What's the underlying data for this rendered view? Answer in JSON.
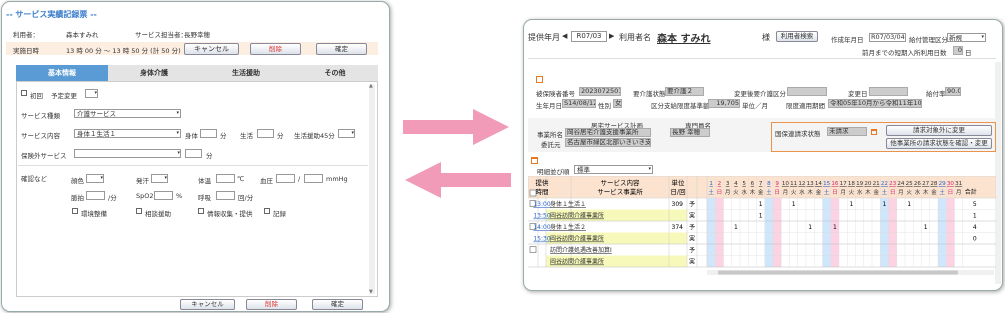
{
  "left": {
    "title": "-- サービス実績記録票 --",
    "user_label": "利用者：",
    "user_name": "森本すみれ",
    "staff_label": "サービス担当者：",
    "staff_name": "長野幸穂",
    "time_label": "実施日時",
    "time_value": "13 時 00 分 〜 13 時 50 分 (計 50 分)",
    "cancel": "キャンセル",
    "delete": "削除",
    "confirm": "確定",
    "tabs": [
      "基本情報",
      "身体介護",
      "生活援助",
      "その他"
    ],
    "first_visit": "初回",
    "schedule_change": "予定変更",
    "service_type_label": "サービス種類",
    "service_type_value": "介護サービス",
    "service_content_label": "サービス内容",
    "service_content_value": "身体１生活１",
    "body_label": "身体",
    "life_label": "生活",
    "life45_label": "生活援助45分",
    "minute": "分",
    "insurance_label": "保険外サービス",
    "confirm_label": "確認など",
    "color_label": "顔色",
    "sweat_label": "発汗",
    "temp_label": "体温",
    "temp_unit": "℃",
    "bp_label": "血圧",
    "bp_sep": "/",
    "bp_unit": "mmHg",
    "pulse_label": "脈拍",
    "pulse_unit": "/分",
    "spo2_label": "SpO2",
    "spo2_unit": "%",
    "resp_label": "呼吸",
    "resp_unit": "回/分",
    "cb1": "環境整備",
    "cb2": "相談援助",
    "cb3": "情報収集・提供",
    "cb4": "記録"
  },
  "right": {
    "year_label": "提供年月",
    "year_value": "R07/03",
    "user_name_label": "利用者名",
    "user_name": "森本 すみれ",
    "sama": "様",
    "search_btn": "利用者検索",
    "created_label": "作成年月日",
    "created_value": "R07/03/04",
    "mgmt_label": "給付管理区分",
    "mgmt_value": "新規",
    "short_label": "前月までの短期入所利用日数",
    "short_value": "0",
    "short_unit": "日",
    "insured_label": "被保険者番号",
    "insured_value": "2023072501",
    "care_label": "要介護状態",
    "care_value": "要介護２",
    "change_label": "変更後要介護区分",
    "change_date_label": "変更日",
    "benefit_label": "給付率",
    "benefit_value": "90.0",
    "birth_label": "生年月日",
    "birth_value": "S14/08/12",
    "sex_label": "性別",
    "sex_value": "女",
    "limit_label": "区分支給限度基準額",
    "limit_value": "19,705",
    "limit_unit": "単位／月",
    "period_label": "限度適用期間",
    "period_value": "令和05年10月から令和11年10月まで",
    "plan_label": "居宅サービス計画",
    "office_label": "事業所名",
    "office_value": "岡谷居宅介護支援事業所",
    "consign_label": "委託元",
    "consign_value": "名古屋市緑区北部いきいき支援センタ",
    "specialist_label": "専門員名",
    "specialist_value": "長野 幸穂",
    "kokuho_label": "国保連請求状態",
    "kokuho_value": "未請求",
    "btn_exclude": "請求対象外に変更",
    "btn_other": "他事業所の請求状態を確認・変更",
    "sort_label": "明細並び順",
    "sort_value": "標準",
    "head_time1": "提供",
    "head_time2": "時間",
    "head_svc1": "サービス内容",
    "head_svc2": "サービス事業所",
    "head_unit1": "単位",
    "head_unit2": "日/回",
    "head_total": "合計",
    "days": [
      "1",
      "2",
      "3",
      "4",
      "5",
      "6",
      "7",
      "8",
      "9",
      "10",
      "11",
      "12",
      "13",
      "14",
      "15",
      "16",
      "17",
      "18",
      "19",
      "20",
      "21",
      "22",
      "23",
      "24",
      "25",
      "26",
      "27",
      "28",
      "29",
      "30",
      "31"
    ],
    "weekdays": [
      "土",
      "日",
      "月",
      "火",
      "水",
      "木",
      "金",
      "土",
      "日",
      "月",
      "火",
      "水",
      "木",
      "金",
      "土",
      "日",
      "月",
      "火",
      "水",
      "木",
      "金",
      "土",
      "日",
      "月",
      "火",
      "水",
      "木",
      "金",
      "土",
      "日",
      "月"
    ],
    "rows": [
      {
        "start": "13:00",
        "end": "13:50",
        "svc": "身体１生活１",
        "office": "岡谷訪問介護事業所",
        "unit": "309",
        "plan": "予",
        "act": "実",
        "plan_total": "5",
        "act_total": "1",
        "plan_marks": [
          "7",
          "11",
          "18",
          "22",
          "25"
        ],
        "act_marks": [
          "7"
        ]
      },
      {
        "start": "14:00",
        "end": "15:30",
        "svc": "身体１生活２",
        "office": "岡谷訪問介護事業所",
        "unit": "374",
        "plan": "予",
        "act": "実",
        "plan_total": "4",
        "act_total": "0",
        "plan_marks": [
          "4",
          "13",
          "16",
          "27"
        ],
        "act_marks": []
      },
      {
        "start": "",
        "end": "",
        "svc": "訪問介護処遇改善加算Ⅰ",
        "office": "岡谷訪問介護事業所",
        "unit": "",
        "plan": "予",
        "act": "実",
        "plan_total": "",
        "act_total": "",
        "plan_marks": [],
        "act_marks": []
      }
    ]
  }
}
